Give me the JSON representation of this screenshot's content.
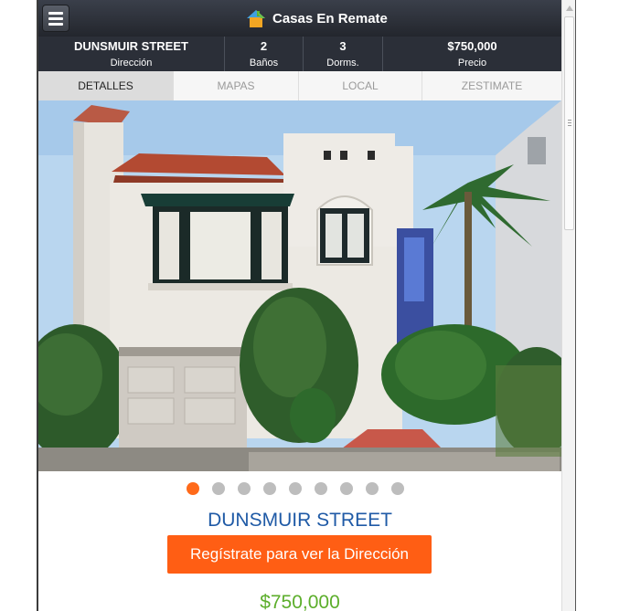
{
  "header": {
    "app_title": "Casas En Remate",
    "menu_icon": "hamburger-menu-icon",
    "logo_icon": "house-logo-icon"
  },
  "info_bar": [
    {
      "value": "DUNSMUIR STREET",
      "label": "Dirección"
    },
    {
      "value": "2",
      "label": "Baños"
    },
    {
      "value": "3",
      "label": "Dorms."
    },
    {
      "value": "$750,000",
      "label": "Precio"
    }
  ],
  "tabs": [
    {
      "label": "DETALLES",
      "active": true
    },
    {
      "label": "MAPAS",
      "active": false
    },
    {
      "label": "LOCAL",
      "active": false
    },
    {
      "label": "ZESTIMATE",
      "active": false
    }
  ],
  "carousel": {
    "total_slides": 9,
    "active_index": 0
  },
  "listing": {
    "title": "DUNSMUIR STREET",
    "cta_label": "Regístrate para ver la Dirección",
    "price": "$750,000"
  },
  "colors": {
    "accent_orange": "#ff5e14",
    "title_blue": "#1f5aa6",
    "price_green": "#5cae2b",
    "header_dark": "#2b2f38"
  }
}
